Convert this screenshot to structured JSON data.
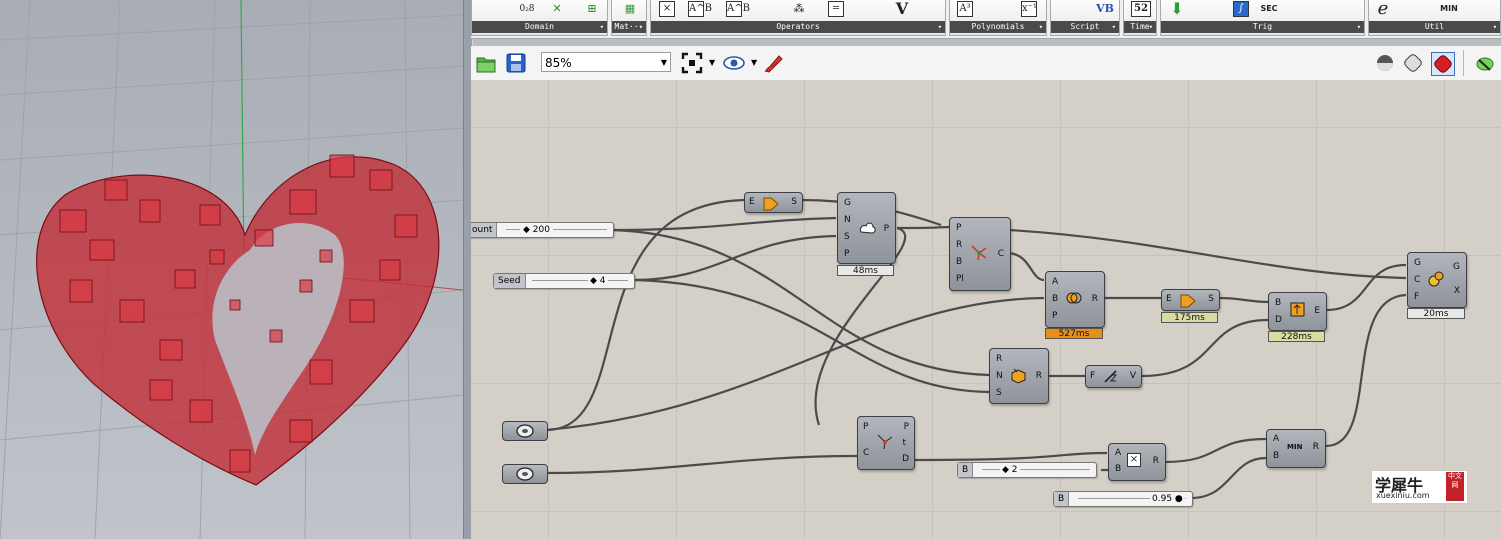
{
  "ribbon": {
    "tabs": [
      "Domain",
      "Mat···",
      "Operators",
      "Polynomials",
      "Script",
      "Time",
      "Trig",
      "Util"
    ],
    "icons": {
      "domain_a": "0₂8 ±±",
      "operators_x": "×",
      "operators_ab": "A^B",
      "operators_abb": "A^B",
      "operators_eq": "=",
      "operators_v": "V",
      "poly_a3": "A³",
      "poly_x1": "x⁻¹",
      "script_vb": "VB",
      "time_cal": "52",
      "trig_sec": "SEC",
      "util_e": "e",
      "util_min": "MIN"
    }
  },
  "toolbar": {
    "zoom": "85%"
  },
  "canvas": {
    "sliders": {
      "count_name": "ount",
      "count_value": "◆ 200",
      "seed_name": "Seed",
      "seed_value": "◆ 4",
      "b2_name": "B",
      "b2_value": "◆ 2",
      "b95_name": "B",
      "b95_value": "0.95 ●"
    },
    "components": {
      "flatten": {
        "in": [
          "E"
        ],
        "out": [
          "S"
        ]
      },
      "populate": {
        "in": [
          "G",
          "N",
          "S",
          "P"
        ],
        "out": [
          "P"
        ],
        "timer": "48ms"
      },
      "voronoi": {
        "in": [
          "P",
          "R",
          "B",
          "Pl"
        ],
        "out": [
          "C"
        ]
      },
      "boolean": {
        "in": [
          "A",
          "B",
          "P"
        ],
        "out": [
          "R"
        ],
        "timer": "527ms"
      },
      "shatter": {
        "in": [
          "E"
        ],
        "out": [
          "S"
        ],
        "timer": "175ms"
      },
      "dispatch": {
        "in": [
          "B",
          "D"
        ],
        "out": [
          "E"
        ],
        "timer": "228ms"
      },
      "custom": {
        "in": [
          "G",
          "C",
          "F"
        ],
        "out": [
          "G",
          "X"
        ],
        "timer": "20ms"
      },
      "random": {
        "in": [
          "R",
          "N",
          "S"
        ],
        "out": [
          "R"
        ]
      },
      "fz": {
        "in": [
          "F"
        ],
        "out": [
          "V"
        ]
      },
      "pull": {
        "in": [
          "P",
          "C"
        ],
        "out": [
          "P",
          "t",
          "D"
        ]
      },
      "multiply": {
        "in": [
          "A",
          "B"
        ],
        "out": [
          "R"
        ]
      },
      "min": {
        "in": [
          "A",
          "B"
        ],
        "out": [
          "R"
        ],
        "label": "MIN"
      }
    }
  },
  "watermark": {
    "cn": "学犀牛",
    "url": "xuexiniu.com",
    "badge": "中文网"
  }
}
